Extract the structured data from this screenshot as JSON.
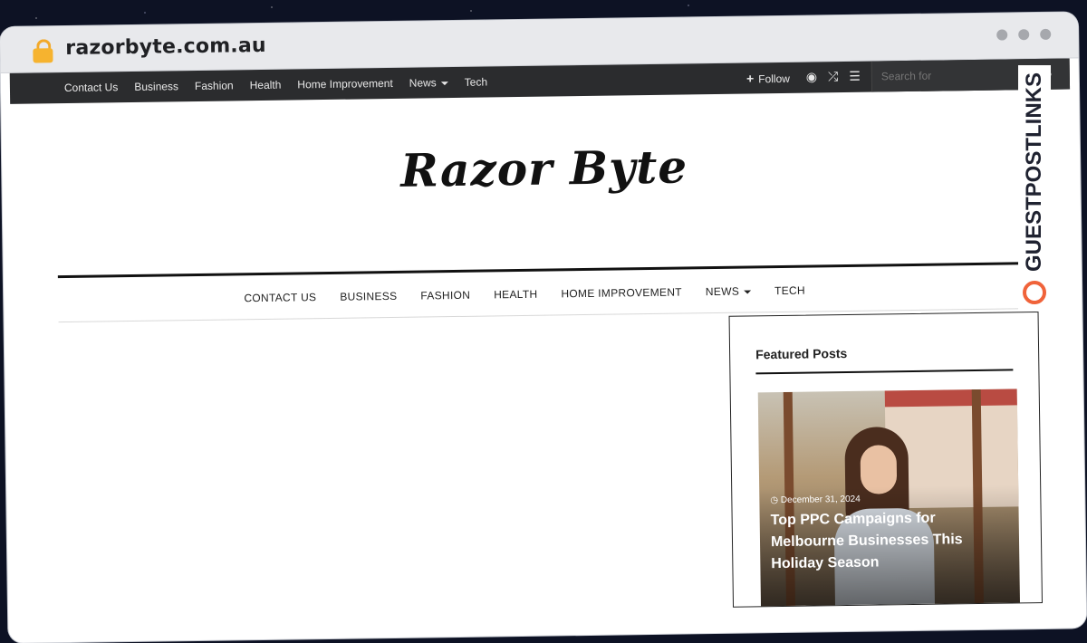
{
  "browser": {
    "url": "razorbyte.com.au"
  },
  "topbar": {
    "nav": [
      "Contact Us",
      "Business",
      "Fashion",
      "Health",
      "Home Improvement",
      "News",
      "Tech"
    ],
    "follow_label": "Follow",
    "search_placeholder": "Search for"
  },
  "site": {
    "logo_text": "Razor Byte"
  },
  "mainnav": {
    "items": [
      "CONTACT US",
      "BUSINESS",
      "FASHION",
      "HEALTH",
      "HOME IMPROVEMENT",
      "NEWS",
      "TECH"
    ]
  },
  "sidebar": {
    "title": "Featured Posts",
    "post": {
      "date": "December 31, 2024",
      "title": "Top PPC Campaigns for Melbourne Businesses This Holiday Season"
    }
  },
  "watermark": {
    "text": "GUESTPOSTLINKS"
  },
  "colors": {
    "topbar_bg": "#2b2c2e",
    "lock": "#f6b32f",
    "brand_accent": "#f0633a"
  }
}
